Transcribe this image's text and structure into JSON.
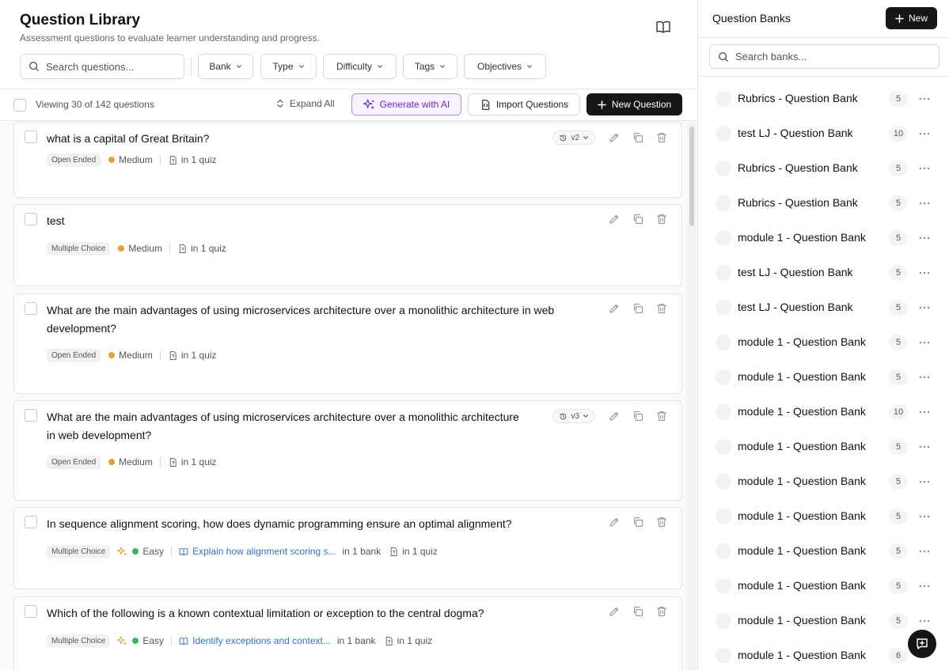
{
  "header": {
    "title": "Question Library",
    "subtitle": "Assessment questions to evaluate learner understanding and progress."
  },
  "search": {
    "placeholder": "Search questions..."
  },
  "filters": [
    {
      "label": "Bank"
    },
    {
      "label": "Type"
    },
    {
      "label": "Difficulty"
    },
    {
      "label": "Tags"
    },
    {
      "label": "Objectives"
    }
  ],
  "toolbar": {
    "viewing": "Viewing 30 of 142 questions",
    "expand_all": "Expand All",
    "generate_ai": "Generate with AI",
    "import": "Import Questions",
    "new_question": "New Question"
  },
  "questions": [
    {
      "text": "what is a capital of Great Britain?",
      "type": "Open Ended",
      "difficulty": "Medium",
      "quiz": "in 1 quiz",
      "version": "v2"
    },
    {
      "text": "test",
      "type": "Multiple Choice",
      "difficulty": "Medium",
      "quiz": "in 1 quiz"
    },
    {
      "text_line1": "What are the main advantages of using microservices architecture over a monolithic architecture in web",
      "text_line2": "development?",
      "type": "Open Ended",
      "difficulty": "Medium",
      "quiz": "in 1 quiz"
    },
    {
      "text_line1": "What are the main advantages of using microservices architecture over a monolithic architecture",
      "text_line2": "in web development?",
      "type": "Open Ended",
      "difficulty": "Medium",
      "quiz": "in 1 quiz",
      "version": "v3"
    },
    {
      "text": "In sequence alignment scoring, how does dynamic programming ensure an optimal alignment?",
      "type": "Multiple Choice",
      "difficulty": "Easy",
      "objective": "Explain how alignment scoring s...",
      "bank": "in 1 bank",
      "quiz": "in 1 quiz"
    },
    {
      "text": "Which of the following is a known contextual limitation or exception to the central dogma?",
      "type": "Multiple Choice",
      "difficulty": "Easy",
      "objective": "Identify exceptions and context...",
      "bank": "in 1 bank",
      "quiz": "in 1 quiz"
    }
  ],
  "banks_panel": {
    "title": "Question Banks",
    "new_label": "New",
    "search_placeholder": "Search banks...",
    "items": [
      {
        "name": "Rubrics - Question Bank",
        "count": "5"
      },
      {
        "name": "test LJ - Question Bank",
        "count": "10"
      },
      {
        "name": "Rubrics - Question Bank",
        "count": "5"
      },
      {
        "name": "Rubrics - Question Bank",
        "count": "5"
      },
      {
        "name": "module 1 - Question Bank",
        "count": "5"
      },
      {
        "name": "test LJ - Question Bank",
        "count": "5"
      },
      {
        "name": "test LJ - Question Bank",
        "count": "5"
      },
      {
        "name": "module 1 - Question Bank",
        "count": "5"
      },
      {
        "name": "module 1 - Question Bank",
        "count": "5"
      },
      {
        "name": "module 1 - Question Bank",
        "count": "10"
      },
      {
        "name": "module 1 - Question Bank",
        "count": "5"
      },
      {
        "name": "module 1 - Question Bank",
        "count": "5"
      },
      {
        "name": "module 1 - Question Bank",
        "count": "5"
      },
      {
        "name": "module 1 - Question Bank",
        "count": "5"
      },
      {
        "name": "module 1 - Question Bank",
        "count": "5"
      },
      {
        "name": "module 1 - Question Bank",
        "count": "5"
      },
      {
        "name": "module 1 - Question Bank",
        "count": "6"
      }
    ]
  },
  "colors": {
    "accent_purple": "#6c2bc0",
    "medium": "#e8a12b",
    "easy": "#3cb45a",
    "link": "#2f73c7",
    "primary_button": "#161616"
  }
}
